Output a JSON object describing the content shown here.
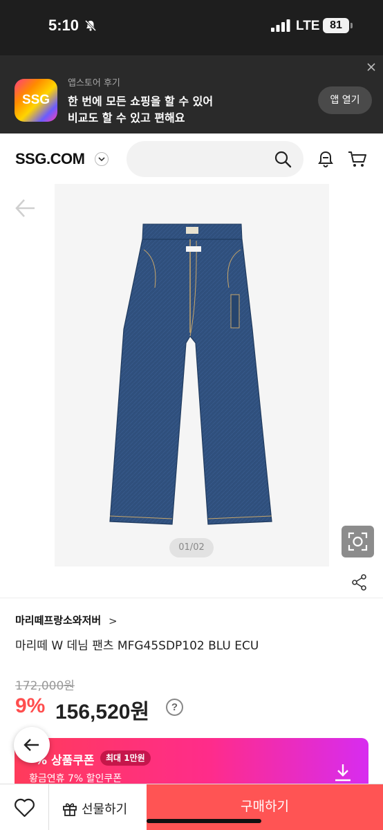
{
  "status_bar": {
    "time": "5:10",
    "network": "LTE",
    "battery": "81"
  },
  "app_banner": {
    "logo_text": "SSG",
    "subtitle": "앱스토어 후기",
    "line1": "한 번에 모든 쇼핑을 할 수 있어",
    "line2": "비교도 할 수 있고 편해요",
    "open_label": "앱 열기"
  },
  "header": {
    "brand": "SSG.COM",
    "search_placeholder": ""
  },
  "gallery": {
    "counter": "01/02"
  },
  "product": {
    "brand": "마리떼프랑소와저버",
    "brand_chevron": ">",
    "title": "마리떼 W 데님 팬츠 MFG45SDP102 BLU ECU",
    "original_price": "172,000원",
    "discount": "9%",
    "sale_price": "156,520원",
    "help_icon": "?"
  },
  "coupon": {
    "title": "% 상품쿠폰",
    "tag": "최대 1만원",
    "subtitle": "황금연휴 7% 할인쿠폰"
  },
  "bottom_bar": {
    "gift_label": "선물하기",
    "buy_label": "구매하기"
  },
  "colors": {
    "accent": "#ff5454",
    "discount": "#ff4e4e",
    "denim": "#2f4f7c"
  }
}
